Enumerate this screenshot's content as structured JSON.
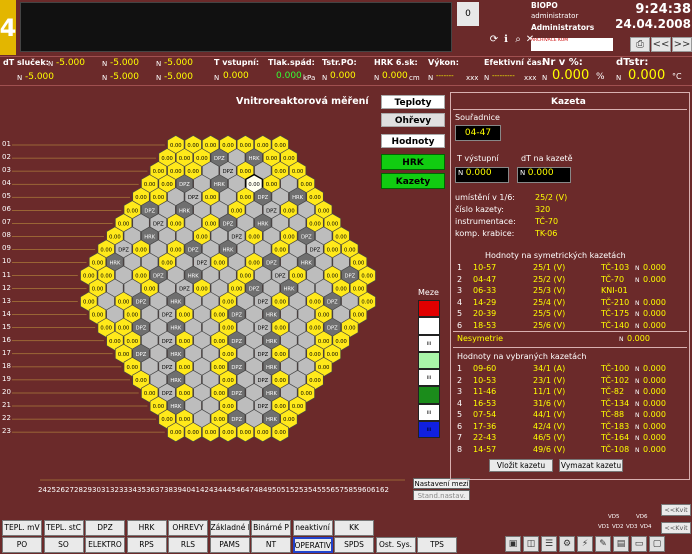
{
  "top": {
    "tab_digit": "4",
    "counter": "0",
    "station": "BIOPO",
    "user1": "administrator",
    "user2": "Administrators",
    "arch_text": "ARCHIVACE KOM",
    "time": "9:24:38",
    "date": "24.04.2008",
    "nav_prev": "<<",
    "nav_next": ">>"
  },
  "strip": {
    "dt_loops_label": "dT sluček:",
    "loops": [
      {
        "n": "N",
        "v": "-5.000"
      },
      {
        "n": "N",
        "v": "-5.000"
      },
      {
        "n": "N",
        "v": "-5.000"
      },
      {
        "n": "N",
        "v": "-5.000"
      },
      {
        "n": "N",
        "v": "-5.000"
      },
      {
        "n": "N",
        "v": "-5.000"
      }
    ],
    "t_in_label": "T vstupní:",
    "t_in": "0.000",
    "dp_label": "Tlak.spád:",
    "dp": "0.000",
    "dp_unit": "kPa",
    "tstr_po_label": "Tstr.PO:",
    "tstr_po": "0.000",
    "hrk_label": "HRK 6.sk:",
    "hrk": "0.000",
    "hrk_unit": "cm",
    "power_label": "Výkon:",
    "power": "-------",
    "power_unit": "xxx",
    "eff_label": "Efektivní čas:",
    "eff": "---------",
    "eff_unit": "xxx",
    "nr_label": "Nr v %:",
    "nr": "0.000",
    "nr_unit": "%",
    "dtstr_label": "dTstr:",
    "dtstr": "0.000",
    "unit_c": "°C",
    "n": "N"
  },
  "map": {
    "title": "Vnitroreaktorová měření",
    "rows": [
      "01",
      "02",
      "03",
      "04",
      "05",
      "06",
      "07",
      "08",
      "09",
      "10",
      "11",
      "12",
      "13",
      "14",
      "15",
      "16",
      "17",
      "18",
      "19",
      "20",
      "21",
      "22",
      "23"
    ],
    "cols": [
      "24",
      "25",
      "26",
      "27",
      "28",
      "29",
      "30",
      "31",
      "32",
      "33",
      "34",
      "35",
      "36",
      "37",
      "38",
      "39",
      "40",
      "41",
      "42",
      "43",
      "44",
      "45",
      "46",
      "47",
      "48",
      "49",
      "50",
      "51",
      "52",
      "53",
      "54",
      "55",
      "56",
      "57",
      "58",
      "59",
      "60",
      "61",
      "62"
    ],
    "cell_value": "0.00",
    "label_dpz": "DPZ",
    "label_hrk": "HRK",
    "colors": {
      "yellow": "#ffe91a",
      "gray": "#bdbdbd",
      "dark": "#6f6f6f",
      "selected": "#fffff0"
    }
  },
  "views": {
    "teploty": "Teploty",
    "ohrevy": "Ohřevy",
    "hodnoty": "Hodnoty",
    "hrk": "HRK",
    "kazety": "Kazety"
  },
  "meze": {
    "label": "Meze",
    "levels": [
      "",
      "",
      "ııı",
      "",
      "ııı",
      "",
      "ııı",
      "ııı"
    ],
    "colors": [
      "#e00000",
      "#ffffff",
      "#ffffff",
      "#a9f5a9",
      "#ffffff",
      "#1b8c1b",
      "#ffffff",
      "#1020e0"
    ]
  },
  "limits": {
    "set": "Nastavení mezí",
    "std": "Stand.nastav."
  },
  "kazeta": {
    "title": "Kazeta",
    "coord_label": "Souřadnice",
    "coord": "04-47",
    "tin_label": "T výstupní",
    "dt_label": "dT na kazetě",
    "tin": "0.000",
    "dt": "0.000",
    "loc_label": "umístění v 1/6:",
    "loc": "25/2 (V)",
    "num_label": "číslo kazety:",
    "num": "320",
    "instr_label": "instrumentace:",
    "instr": "TČ-70",
    "comp_label": "komp. krabice:",
    "comp": "TK-06",
    "sym_title": "Hodnoty na symetrických kazetách",
    "sym": [
      {
        "i": "1",
        "c": "10-57",
        "p": "25/1 (V)",
        "t": "TČ-103",
        "v": "0.000"
      },
      {
        "i": "2",
        "c": "04-47",
        "p": "25/2 (V)",
        "t": "TČ-70",
        "v": "0.000"
      },
      {
        "i": "3",
        "c": "06-33",
        "p": "25/3 (V)",
        "t": "KNI-01",
        "v": ""
      },
      {
        "i": "4",
        "c": "14-29",
        "p": "25/4 (V)",
        "t": "TČ-210",
        "v": "0.000"
      },
      {
        "i": "5",
        "c": "20-39",
        "p": "25/5 (V)",
        "t": "TČ-175",
        "v": "0.000"
      },
      {
        "i": "6",
        "c": "18-53",
        "p": "25/6 (V)",
        "t": "TČ-140",
        "v": "0.000"
      }
    ],
    "nesym_label": "Nesymetrie",
    "nesym": "0.000",
    "sel_title": "Hodnoty na vybraných kazetách",
    "sel": [
      {
        "i": "1",
        "c": "09-60",
        "p": "34/1 (A)",
        "t": "TČ-100",
        "v": "0.000"
      },
      {
        "i": "2",
        "c": "10-53",
        "p": "23/1 (V)",
        "t": "TČ-102",
        "v": "0.000"
      },
      {
        "i": "3",
        "c": "11-46",
        "p": "11/1 (V)",
        "t": "TČ-82",
        "v": "0.000"
      },
      {
        "i": "4",
        "c": "16-53",
        "p": "31/6 (V)",
        "t": "TČ-134",
        "v": "0.000"
      },
      {
        "i": "5",
        "c": "07-54",
        "p": "44/1 (V)",
        "t": "TČ-88",
        "v": "0.000"
      },
      {
        "i": "6",
        "c": "17-36",
        "p": "42/4 (V)",
        "t": "TČ-183",
        "v": "0.000"
      },
      {
        "i": "7",
        "c": "22-43",
        "p": "46/5 (V)",
        "t": "TČ-164",
        "v": "0.000"
      },
      {
        "i": "8",
        "c": "14-57",
        "p": "49/6 (V)",
        "t": "TČ-108",
        "v": "0.000"
      }
    ],
    "btn_insert": "Vložit kazetu",
    "btn_clear": "Vymazat kazetu"
  },
  "bottom": {
    "row1": [
      "TEPL. mV",
      "TEPL. stC",
      "DPZ",
      "HRK",
      "OHREVY",
      "Základné P",
      "Binárné P",
      "neaktivní",
      "KK"
    ],
    "row2": [
      "PO",
      "SO",
      "ELEKTRO",
      "RPS",
      "RLS",
      "PAMS",
      "NT",
      "OPERATIV",
      "SPDS",
      "Ost. Sys.",
      "TPS"
    ],
    "vd": [
      "VD5",
      "VD6",
      "VD1",
      "VD2",
      "VD3",
      "VD4"
    ],
    "kvit1": "<<Kvit",
    "kvit2": "<<Kvit"
  }
}
